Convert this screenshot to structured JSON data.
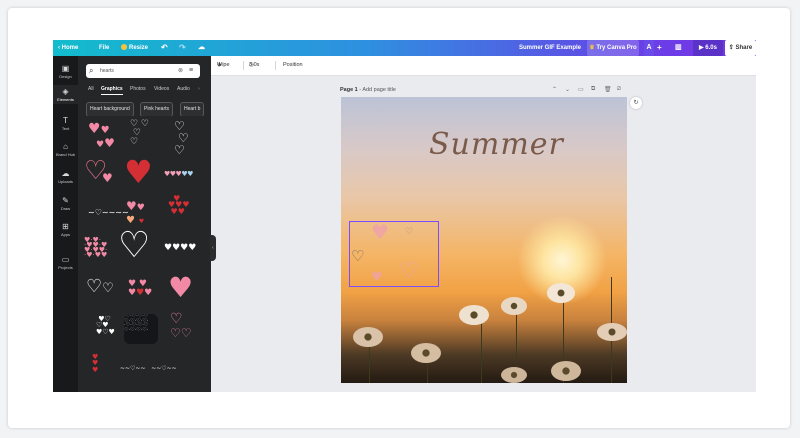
{
  "topbar": {
    "home": "Home",
    "file": "File",
    "resize": "Resize",
    "undo_icon": "undo-icon",
    "redo_icon": "redo-icon",
    "cloud_icon": "cloud-save-icon",
    "design_title": "Summer GIF Example",
    "try_pro": "Try Canva Pro",
    "brand_letter": "A",
    "plus": "+",
    "play_label": "6.0s",
    "share": "Share"
  },
  "rail": {
    "items": [
      {
        "label": "Design",
        "icon": "layout-icon"
      },
      {
        "label": "Elements",
        "icon": "shapes-icon"
      },
      {
        "label": "Text",
        "icon": "text-icon"
      },
      {
        "label": "Brand Hub",
        "icon": "brand-icon"
      },
      {
        "label": "Uploads",
        "icon": "cloud-upload-icon"
      },
      {
        "label": "Draw",
        "icon": "pen-icon"
      },
      {
        "label": "Apps",
        "icon": "apps-grid-icon"
      },
      {
        "label": "Projects",
        "icon": "folder-icon"
      }
    ]
  },
  "panel": {
    "search": {
      "value": "hearts",
      "placeholder": "Search elements"
    },
    "tabs": [
      "All",
      "Graphics",
      "Photos",
      "Videos",
      "Audio"
    ],
    "active_tab": "Graphics",
    "chips": [
      "Heart background",
      "Pink hearts",
      "Heart b"
    ]
  },
  "context_bar": {
    "wipe": "Wipe",
    "duration": "3.0s",
    "position": "Position"
  },
  "page": {
    "label": "Page 1",
    "title_placeholder": "- Add page title"
  },
  "canvas": {
    "headline": "Summer"
  },
  "colors": {
    "accent": "#7c4dff",
    "heart_pink": "#f28aa6",
    "heart_red": "#d42f35",
    "panel_bg": "#252627",
    "rail_bg": "#18191b"
  }
}
